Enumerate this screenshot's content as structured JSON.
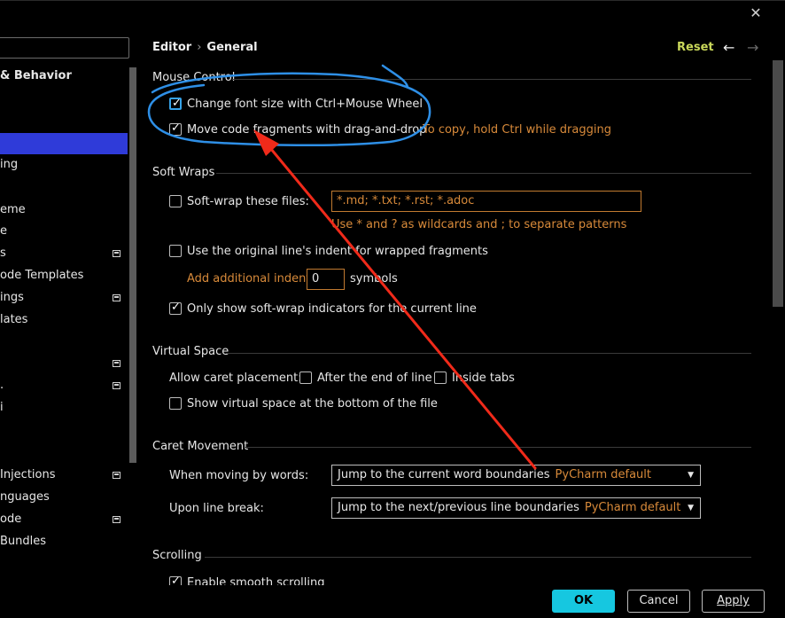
{
  "sidebar": {
    "items": [
      {
        "label": "& Behavior",
        "bold": true,
        "icon": false
      },
      {
        "label": "",
        "bold": false,
        "icon": false
      },
      {
        "label": "ing",
        "bold": false,
        "icon": false
      },
      {
        "label": "eme",
        "bold": false,
        "icon": false
      },
      {
        "label": "e",
        "bold": false,
        "icon": false
      },
      {
        "label": "s",
        "bold": false,
        "icon": true
      },
      {
        "label": "ode Templates",
        "bold": false,
        "icon": false
      },
      {
        "label": "ings",
        "bold": false,
        "icon": true
      },
      {
        "label": "lates",
        "bold": false,
        "icon": false
      },
      {
        "label": "",
        "bold": false,
        "icon": true
      },
      {
        "label": ".",
        "bold": false,
        "icon": true
      },
      {
        "label": "i",
        "bold": false,
        "icon": false
      },
      {
        "label": "Injections",
        "bold": false,
        "icon": true
      },
      {
        "label": "nguages",
        "bold": false,
        "icon": false
      },
      {
        "label": "ode",
        "bold": false,
        "icon": true
      },
      {
        "label": "Bundles",
        "bold": false,
        "icon": false
      }
    ]
  },
  "header": {
    "breadcrumb": [
      "Editor",
      "General"
    ],
    "reset_label": "Reset"
  },
  "mouse_control": {
    "title": "Mouse Control",
    "font_size_label": "Change font size with Ctrl+Mouse Wheel",
    "drag_label": "Move code fragments with drag-and-drop",
    "drag_hint": "To copy, hold Ctrl while dragging"
  },
  "soft_wraps": {
    "title": "Soft Wraps",
    "files_label": "Soft-wrap these files:",
    "files_value": "*.md; *.txt; *.rst; *.adoc",
    "files_hint": "Use * and ? as wildcards and ; to separate patterns",
    "indent_label": "Use the original line's indent for wrapped fragments",
    "additional_indent_label": "Add additional indent:",
    "additional_indent_value": "0",
    "symbols_label": "symbols",
    "indicators_label": "Only show soft-wrap indicators for the current line"
  },
  "virtual_space": {
    "title": "Virtual Space",
    "caret_label": "Allow caret placement:",
    "after_end_label": "After the end of line",
    "inside_tabs_label": "Inside tabs",
    "bottom_label": "Show virtual space at the bottom of the file"
  },
  "caret_movement": {
    "title": "Caret Movement",
    "words_label": "When moving by words:",
    "words_value": "Jump to the current word boundaries",
    "words_default": "PyCharm default",
    "break_label": "Upon line break:",
    "break_value": "Jump to the next/previous line boundaries",
    "break_default": "PyCharm default"
  },
  "scrolling": {
    "title": "Scrolling",
    "partial_label": "Enable smooth scrolling"
  },
  "buttons": {
    "ok": "OK",
    "cancel": "Cancel",
    "apply": "Apply"
  },
  "colors": {
    "accent_selection": "#2f3bd9",
    "ok_button": "#16c7e0",
    "hint_orange": "#d88a3a",
    "reset_yellow": "#c9d75a",
    "annotation_blue": "#2e8fe6",
    "annotation_red": "#f02a1a"
  }
}
